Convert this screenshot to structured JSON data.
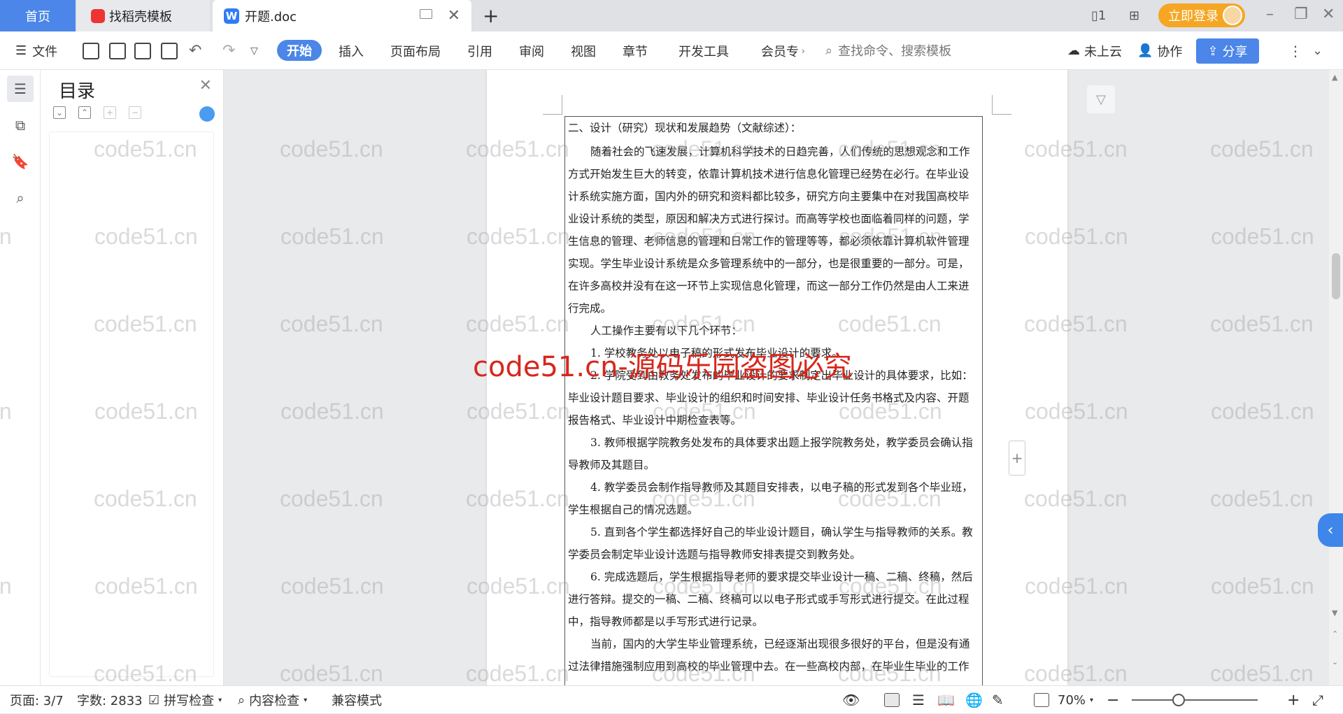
{
  "tabs": {
    "home": "首页",
    "template": "找稻壳模板",
    "document": "开题.doc"
  },
  "top_right": {
    "login": "立即登录"
  },
  "toolbar": {
    "file": "文件",
    "menus": [
      "开始",
      "插入",
      "页面布局",
      "引用",
      "审阅",
      "视图",
      "章节",
      "开发工具",
      "会员专"
    ],
    "search_placeholder": "查找命令、搜索模板",
    "cloud": "未上云",
    "collab": "协作",
    "share": "分享"
  },
  "toc": {
    "title": "目录"
  },
  "document": {
    "heading": "二、设计（研究）现状和发展趋势（文献综述）：",
    "paragraphs": [
      "随着社会的飞速发展，计算机科学技术的日趋完善，人们传统的思想观念和工作方式开始发生巨大的转变，依靠计算机技术进行信息化管理已经势在必行。在毕业设计系统实施方面，国内外的研究和资料都比较多，研究方向主要集中在对我国高校毕业设计系统的类型，原因和解决方式进行探讨。而高等学校也面临着同样的问题，学生信息的管理、老师信息的管理和日常工作的管理等等，都必须依靠计算机软件管理实现。学生毕业设计系统是众多管理系统中的一部分，也是很重要的一部分。可是，在许多高校并没有在这一环节上实现信息化管理，而这一部分工作仍然是由人工来进行完成。",
      "人工操作主要有以下几个环节：",
      "1. 学校教务处以电子稿的形式发布毕业设计的要求。",
      "2. 学院受到由教务处发布的毕业设计的要求制定出毕业设计的具体要求，比如：毕业设计题目要求、毕业设计的组织和时间安排、毕业设计任务书格式及内容、开题报告格式、毕业设计中期检查表等。",
      "3. 教师根据学院教务处发布的具体要求出题上报学院教务处，教学委员会确认指导教师及其题目。",
      "4. 教学委员会制作指导教师及其题目安排表，以电子稿的形式发到各个毕业班，学生根据自己的情况选题。",
      "5. 直到各个学生都选择好自己的毕业设计题目，确认学生与指导教师的关系。教学委员会制定毕业设计选题与指导教师安排表提交到教务处。",
      "6. 完成选题后，学生根据指导老师的要求提交毕业设计一稿、二稿、终稿，然后进行答辩。提交的一稿、二稿、终稿可以以电子形式或手写形式进行提交。在此过程中，指导教师都是以手写形式进行记录。",
      "当前，国内的大学生毕业管理系统，已经逐渐出现很多很好的平台，但是没有通过法律措施强制应用到高校的毕业管理中去。在一些高校内部，在毕业生毕业的工作"
    ]
  },
  "watermark": {
    "text": "code51.cn",
    "red_text": "code51.cn-源码乐园盗图必究"
  },
  "status": {
    "page": "页面: 3/7",
    "words": "字数: 2833",
    "spell": "拼写检查",
    "content": "内容检查",
    "compat": "兼容模式",
    "zoom": "70%"
  }
}
